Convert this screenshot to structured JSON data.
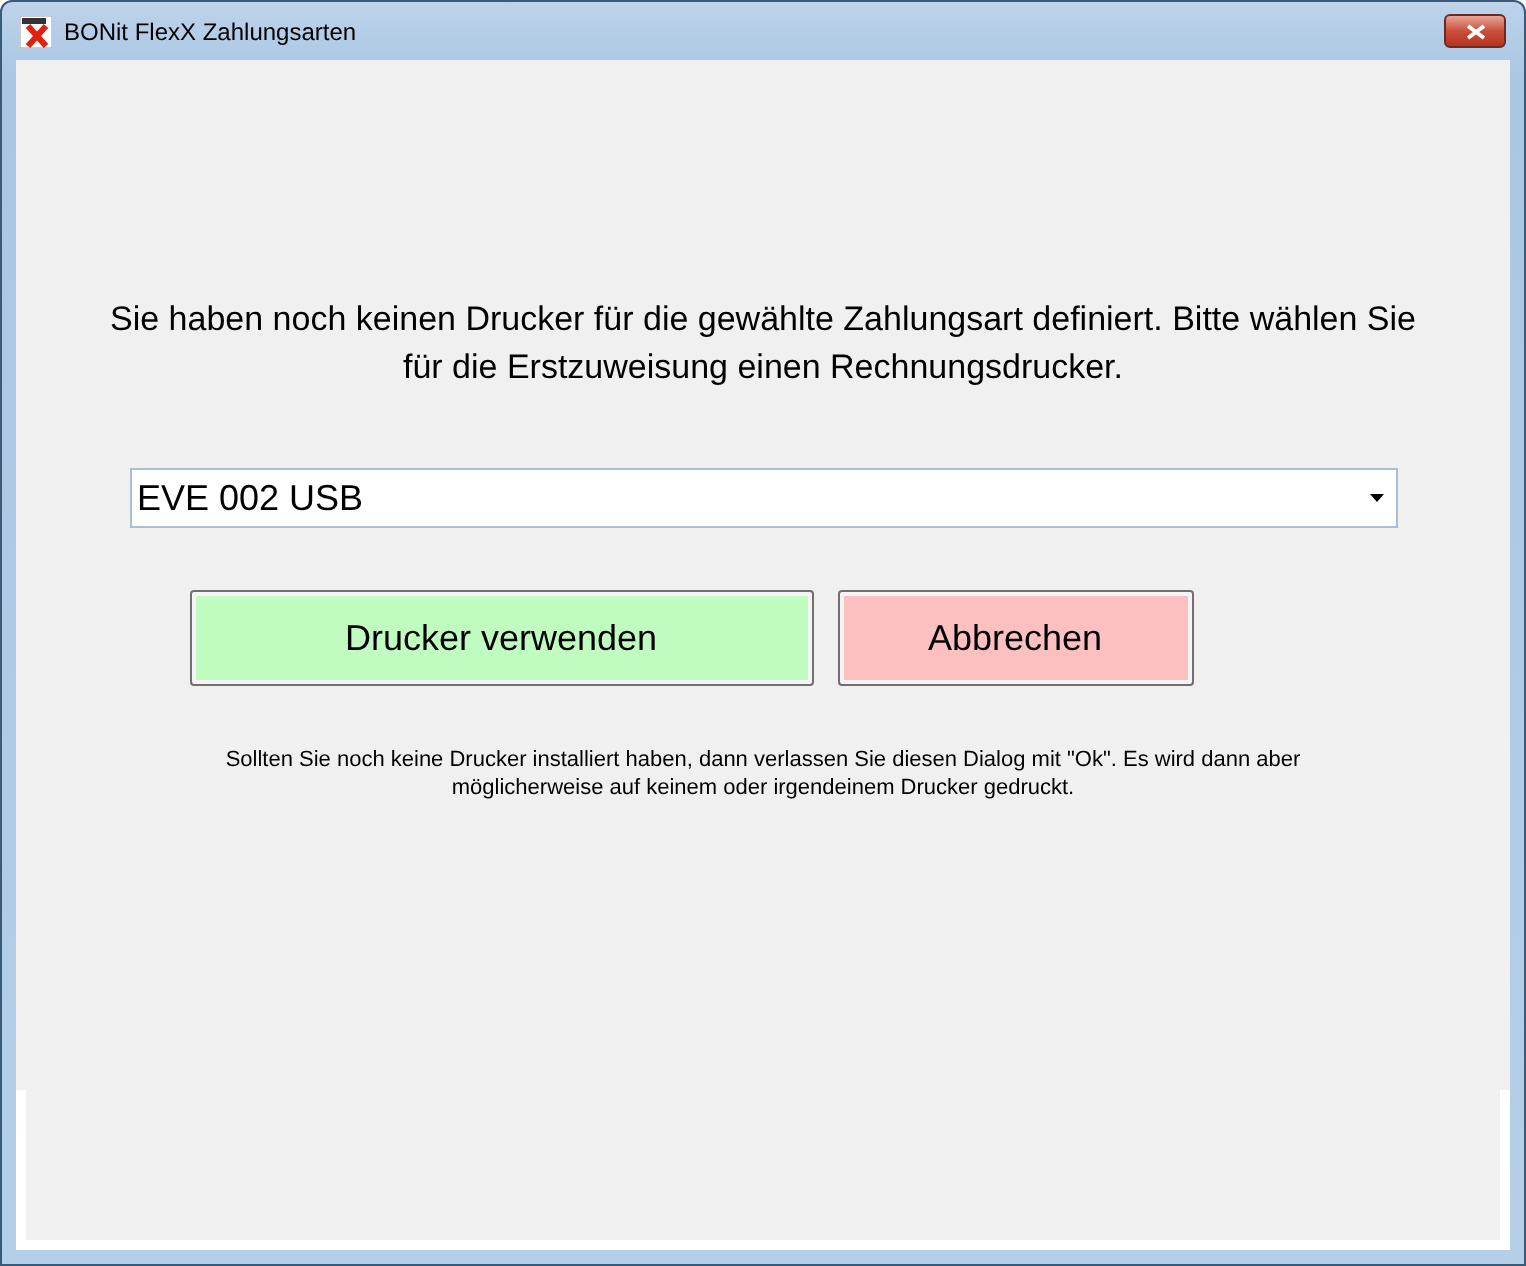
{
  "window": {
    "title": "BONit FlexX Zahlungsarten"
  },
  "message": "Sie haben noch keinen Drucker für die gewählte Zahlungsart definiert. Bitte wählen Sie für die Erstzuweisung einen Rechnungsdrucker.",
  "printer_select": {
    "value": "EVE 002 USB"
  },
  "buttons": [
    {
      "label": "Drucker verwenden",
      "kind": "confirm"
    },
    {
      "label": "Abbrechen",
      "kind": "cancel"
    }
  ],
  "hint": "Sollten Sie noch keine Drucker installiert haben, dann verlassen Sie diesen Dialog mit \"Ok\". Es wird dann aber möglicherweise auf keinem oder irgendeinem Drucker gedruckt."
}
